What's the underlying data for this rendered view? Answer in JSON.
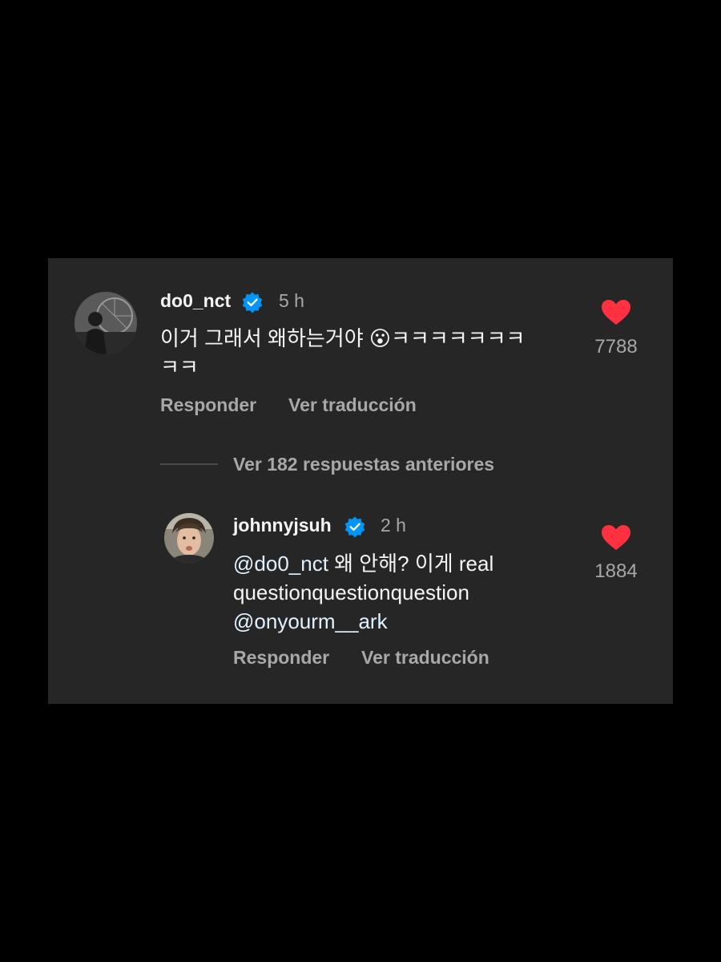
{
  "comment": {
    "username": "do0_nct",
    "time": "5 h",
    "text_line1": "이거 그래서 왜하는거야 😮ㅋㅋㅋㅋㅋㅋㅋ",
    "text_line2": "ㅋㅋ",
    "like_count": "7788",
    "reply_label": "Responder",
    "translate_label": "Ver traducción"
  },
  "view_replies_label": "Ver 182 respuestas anteriores",
  "reply": {
    "username": "johnnyjsuh",
    "time": "2 h",
    "mention1": "@do0_nct",
    "text_line1_rest": " 왜 안해? 이게 real",
    "text_line2": "questionquestionquestion",
    "mention2": "@onyourm__ark",
    "like_count": "1884",
    "reply_label": "Responder",
    "translate_label": "Ver traducción"
  },
  "colors": {
    "background": "#000000",
    "panel": "#262626",
    "heart": "#ff3040",
    "verified": "#0095f6"
  }
}
